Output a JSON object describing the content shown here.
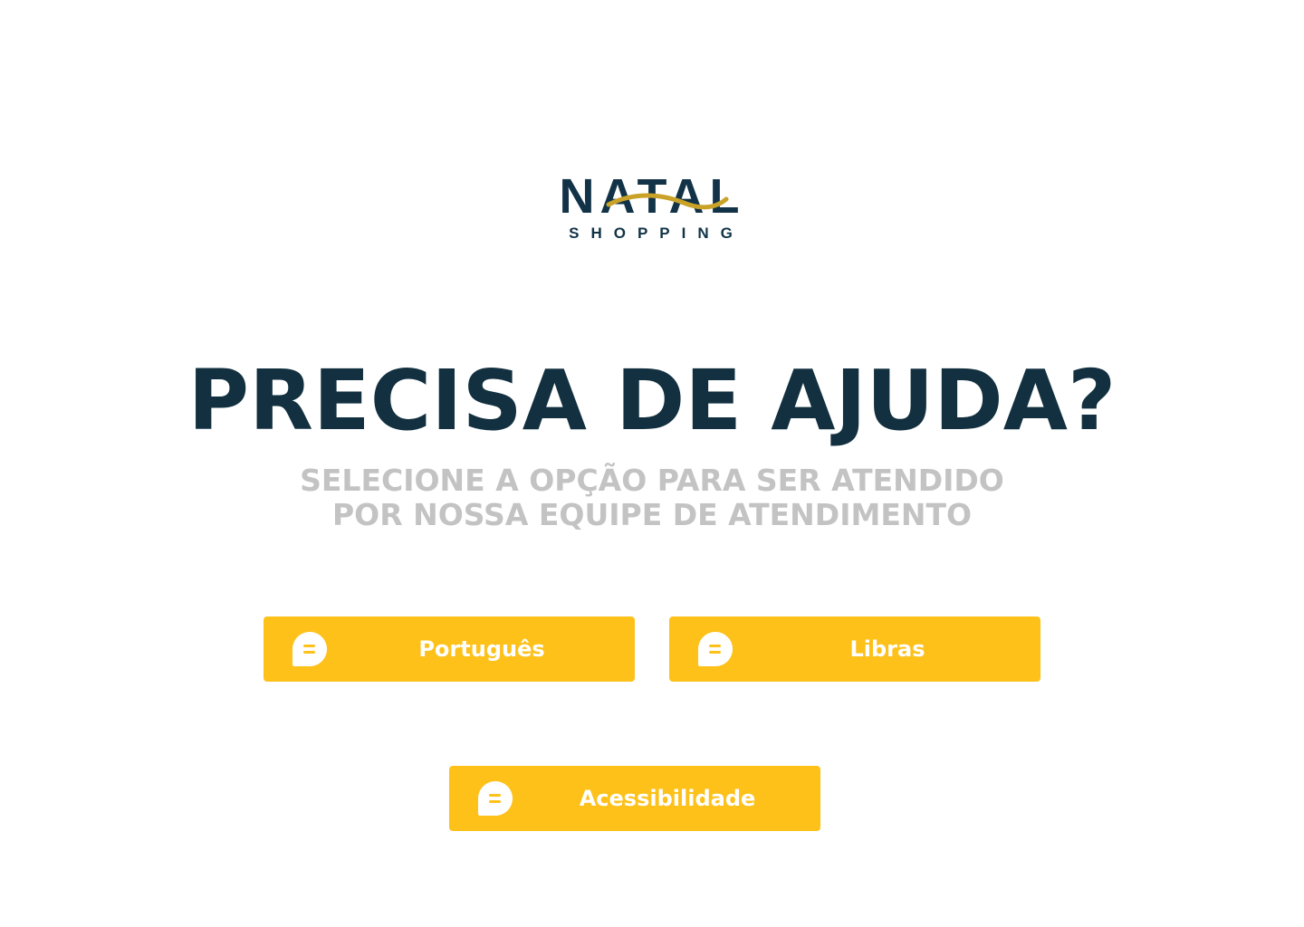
{
  "logo": {
    "wordmark": "NATAL",
    "tagline": "SHOPPING",
    "brand_color": "#123347",
    "accent_color": "#c9a227"
  },
  "headline": "PRECISA DE AJUDA?",
  "subtitle": {
    "line1": "SELECIONE A OPÇÃO PARA SER ATENDIDO",
    "line2": "POR NOSSA EQUIPE DE ATENDIMENTO"
  },
  "options": [
    {
      "label": "Português",
      "icon": "chat-bubble-icon"
    },
    {
      "label": "Libras",
      "icon": "chat-bubble-icon"
    },
    {
      "label": "Acessibilidade",
      "icon": "chat-bubble-icon"
    }
  ],
  "colors": {
    "button": "#fdc11a",
    "button_text": "#ffffff",
    "headline": "#12303f",
    "subtitle": "#c3c3c3"
  }
}
